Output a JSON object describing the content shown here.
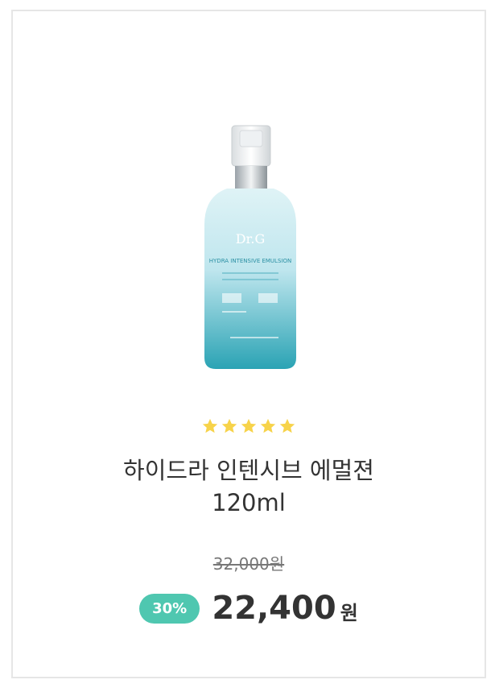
{
  "product": {
    "rating_stars": 5,
    "title_line1": "하이드라 인텐시브 에멀젼",
    "title_line2": "120ml",
    "original_price": "32,000원",
    "discount_label": "30%",
    "sale_price": "22,400",
    "currency": "원",
    "image_brand": "Dr.G",
    "image_label": "HYDRA INTENSIVE EMULSION"
  },
  "colors": {
    "star": "#f7d34a",
    "discount_badge": "#4fc7b0",
    "bottle_top": "#dff3f6",
    "bottle_bottom": "#2aa3b4"
  }
}
